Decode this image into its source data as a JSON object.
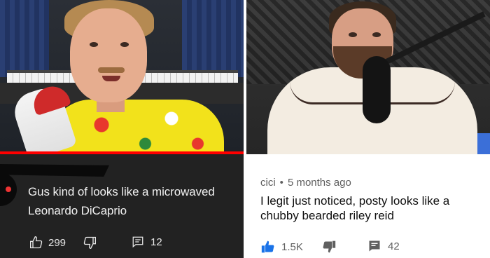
{
  "left": {
    "video_progress_percent": 100,
    "comment": {
      "text": "Gus kind of looks like a microwaved Leonardo DiCaprio",
      "likes": "299",
      "replies": "12"
    }
  },
  "right": {
    "comment": {
      "author": "cici",
      "separator": "•",
      "timestamp": "5 months ago",
      "text": "I legit just noticed, posty looks like a chubby bearded riley reid",
      "likes": "1.5K",
      "replies": "42"
    }
  },
  "colors": {
    "left_bg": "#222222",
    "progress_red": "#ff0000",
    "like_blue": "#1a73e8",
    "right_bg": "#ffffff"
  },
  "icons": [
    "thumbs-up-icon",
    "thumbs-down-icon",
    "reply-icon"
  ]
}
